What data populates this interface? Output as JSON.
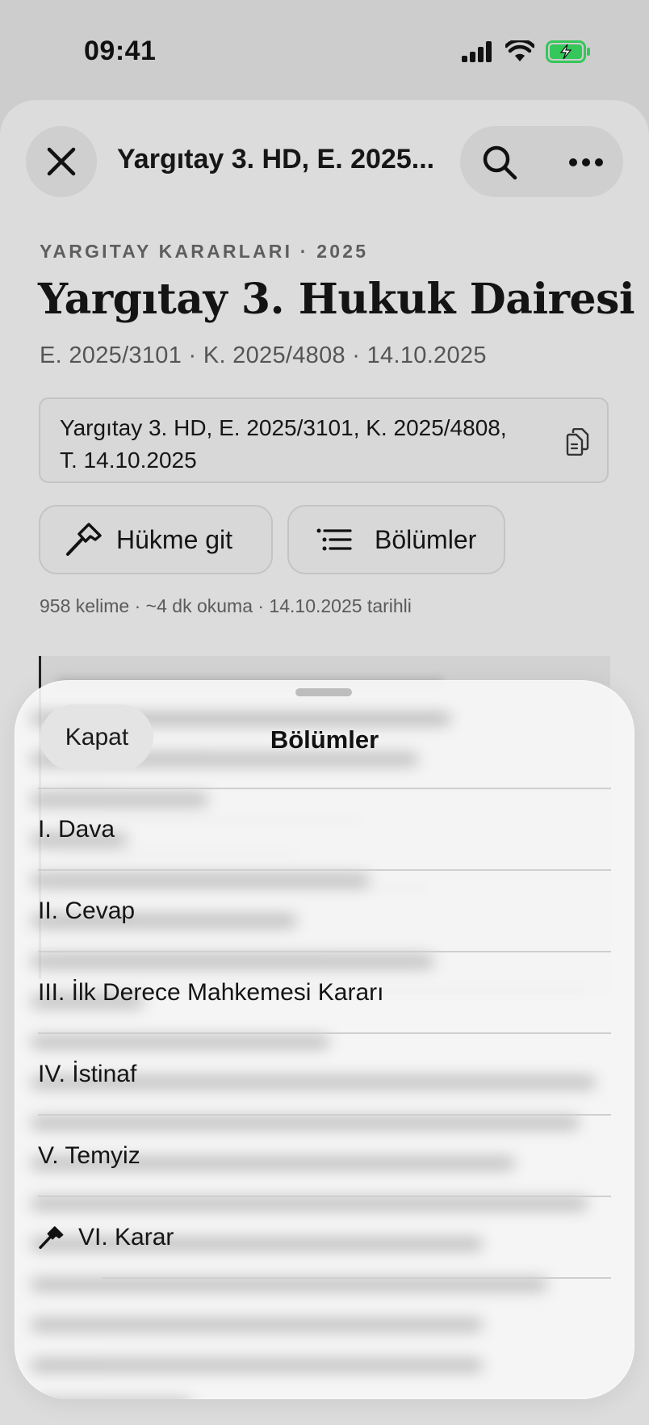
{
  "status_bar": {
    "time": "09:41"
  },
  "nav": {
    "title": "Yargıtay 3. HD, E. 2025..."
  },
  "document": {
    "eyebrow": "YARGITAY KARARLARI · 2025",
    "court": "Yargıtay 3. Hukuk Dairesi",
    "meta": "E. 2025/3101 · K. 2025/4808 · 14.10.2025",
    "citation": "Yargıtay 3. HD, E. 2025/3101, K. 2025/4808, T. 14.10.2025",
    "buttons": {
      "goto_ruling": "Hükme git",
      "sections": "Bölümler"
    },
    "stats": "958 kelime · ~4 dk okuma · 14.10.2025 tarihli"
  },
  "sections_sheet": {
    "close_label": "Kapat",
    "title": "Bölümler",
    "items": [
      {
        "label": "I. Dava"
      },
      {
        "label": "II. Cevap"
      },
      {
        "label": "III. İlk Derece Mahkemesi Kararı"
      },
      {
        "label": "IV. İstinaf"
      },
      {
        "label": "V. Temyiz"
      },
      {
        "label": "VI. Karar",
        "icon": "gavel-icon"
      }
    ]
  },
  "colors": {
    "battery": "#34c759",
    "accent": "#141414"
  }
}
